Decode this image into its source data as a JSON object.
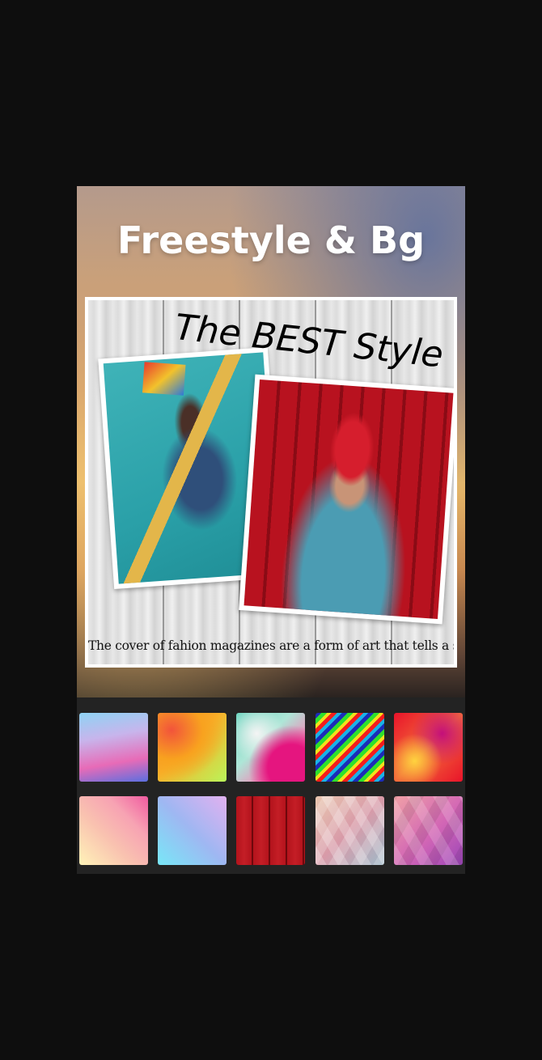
{
  "hero": {
    "title": "Freestyle & Bg"
  },
  "collage": {
    "heading": "The BEST Style",
    "caption": "The cover of fahion magazines are a form of art that tells a story"
  },
  "backgrounds": {
    "row1": [
      {
        "name": "gradient-blue-pink",
        "colors": [
          "#8fd3f4",
          "#e76bb7",
          "#5b6fe0"
        ]
      },
      {
        "name": "gradient-orange-lime",
        "colors": [
          "#f2543b",
          "#f8a21f",
          "#b9f55a"
        ]
      },
      {
        "name": "marble-teal-pink",
        "colors": [
          "#6fd5c0",
          "#f4f4f4",
          "#e5157f"
        ]
      },
      {
        "name": "neon-stripes",
        "colors": [
          "#1b2cb8",
          "#2ee12b",
          "#f41c1c"
        ]
      },
      {
        "name": "fluid-red-yellow",
        "colors": [
          "#e9132a",
          "#ffd23f",
          "#c40f7a"
        ]
      }
    ],
    "row2": [
      {
        "name": "gradient-cream-pink",
        "colors": [
          "#fff3b8",
          "#f7a3b3",
          "#f05aa0"
        ]
      },
      {
        "name": "gradient-cyan-lilac",
        "colors": [
          "#78e7f7",
          "#9fb7f2",
          "#e2b1f0"
        ]
      },
      {
        "name": "red-wood-planks",
        "colors": [
          "#b3131c",
          "#8e0b12",
          "#c41e26"
        ]
      },
      {
        "name": "geometric-pastel",
        "colors": [
          "#e9c7b0",
          "#d89aa8",
          "#9fb9c8"
        ]
      },
      {
        "name": "geometric-magenta",
        "colors": [
          "#f0a1a6",
          "#d266b5",
          "#9c46b8"
        ]
      }
    ]
  }
}
